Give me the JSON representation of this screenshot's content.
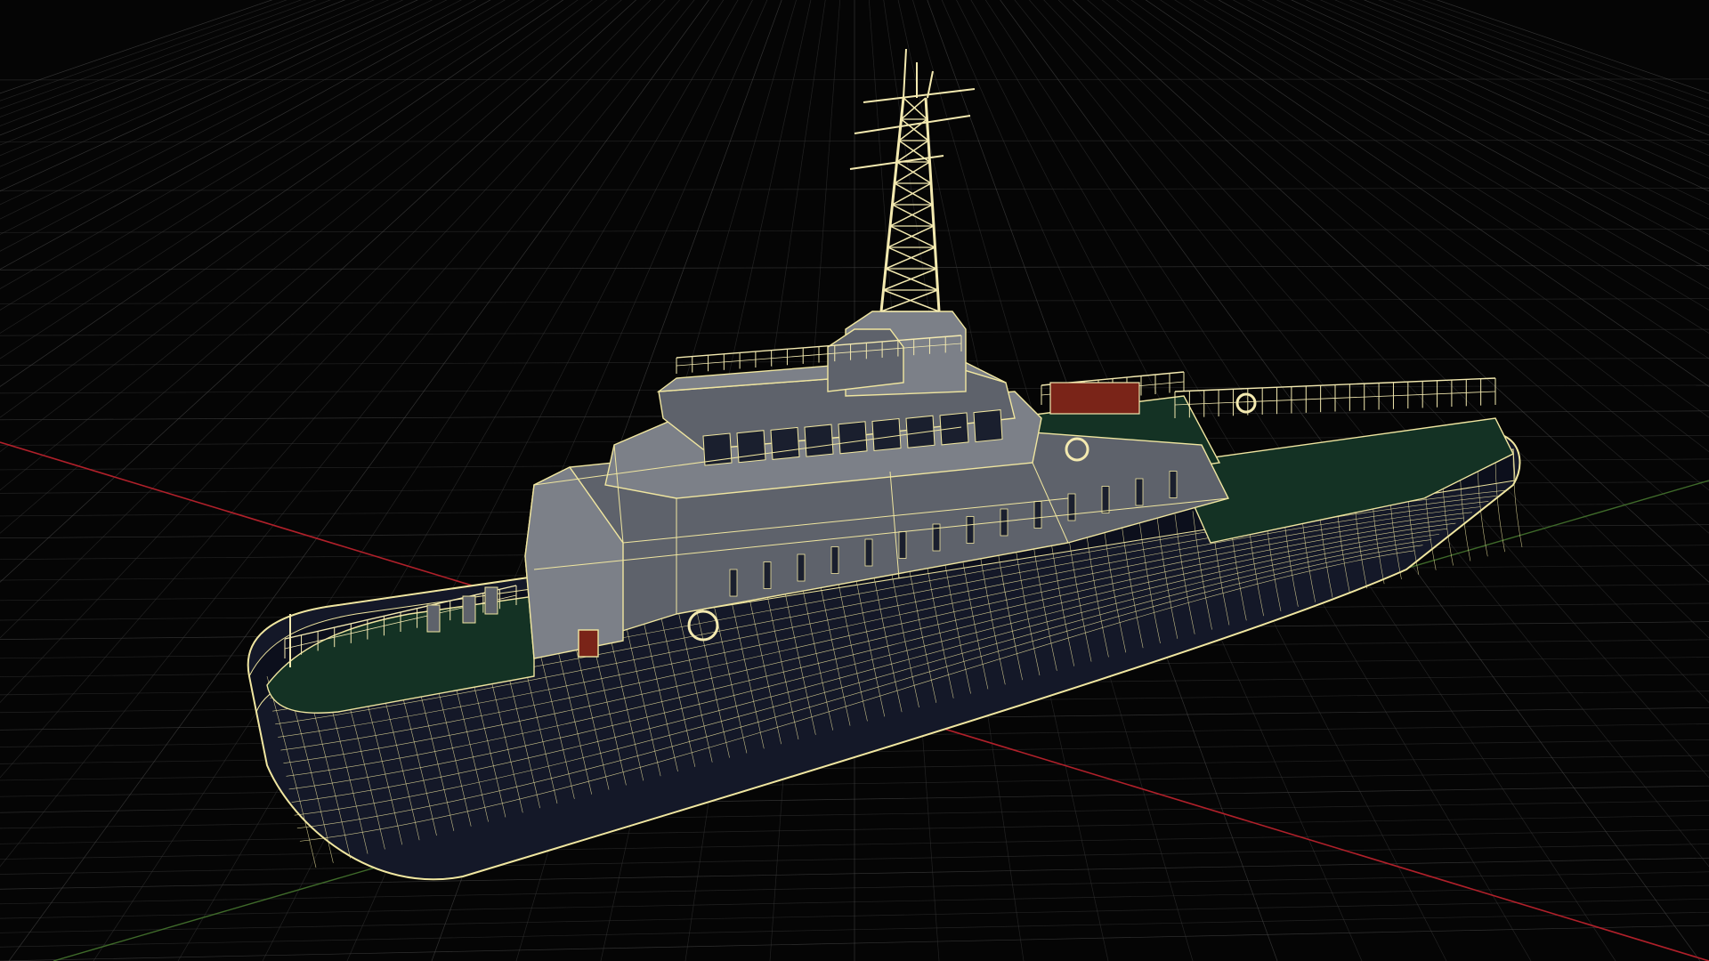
{
  "viewport": {
    "background": "#050505",
    "grid_color": "#3a3a3a",
    "grid_major_color": "#555555",
    "x_axis_color": "#b0202a",
    "z_axis_color": "#3f6a2a",
    "grid_visible": true,
    "shading": "wireframe-on-shaded",
    "projection": "perspective"
  },
  "model": {
    "subject": "patrol-vessel",
    "wire_color": "#f0e6a0",
    "hull_color": "#141828",
    "hull_dark_color": "#0c0f1c",
    "superstructure_color": "#7c8088",
    "superstructure_shade": "#5e626b",
    "deck_color": "#143224",
    "window_color": "#1a1f2e",
    "accent_red": "#7a2418",
    "rail_color": "#f4eab0"
  }
}
